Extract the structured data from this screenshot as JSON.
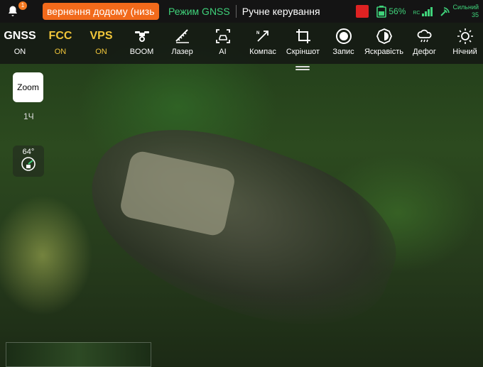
{
  "topbar": {
    "notification_count": "1",
    "alert_text": "вернення додому (низь",
    "flight_mode": "Режим GNSS",
    "control_mode": "Ручне керування",
    "battery_percent": "56%",
    "rc_label": "RC",
    "signal_label": "Сильний",
    "signal_value": "35"
  },
  "toolbar": [
    {
      "name": "gnss",
      "top": "GNSS",
      "label": "ON"
    },
    {
      "name": "fcc",
      "top": "FCC",
      "label": "ON"
    },
    {
      "name": "vps",
      "top": "VPS",
      "label": "ON"
    },
    {
      "name": "boom",
      "icon": "drone-icon",
      "label": "BOOM"
    },
    {
      "name": "laser",
      "icon": "laser-ruler-icon",
      "label": "Лазер"
    },
    {
      "name": "ai",
      "icon": "ai-car-icon",
      "label": "AI"
    },
    {
      "name": "compass",
      "icon": "compass-icon",
      "label": "Компас"
    },
    {
      "name": "screenshot",
      "icon": "crop-icon",
      "label": "Скріншот"
    },
    {
      "name": "record",
      "icon": "record-icon",
      "label": "Запис"
    },
    {
      "name": "brightness",
      "icon": "brightness-icon",
      "label": "Яскравість"
    },
    {
      "name": "defog",
      "icon": "defog-icon",
      "label": "Дефог"
    },
    {
      "name": "night",
      "icon": "night-mode-icon",
      "label": "Нічний"
    }
  ],
  "left": {
    "zoom_label": "Zoom",
    "zoom_level": "1Ч",
    "compass_degrees": "64°"
  },
  "colors": {
    "accent_green": "#3fd27a",
    "alert_orange": "#f26a1b",
    "on_yellow": "#f0c53a"
  }
}
